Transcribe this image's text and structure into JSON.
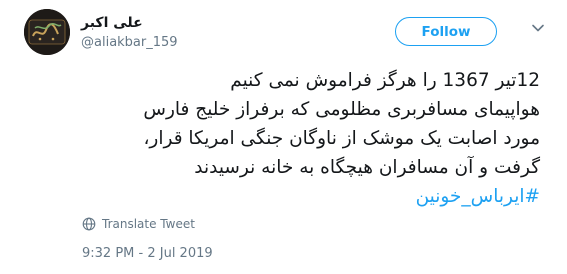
{
  "author": {
    "display_name": "علی اکبر",
    "username": "@aliakbar_159",
    "avatar_icon": "calligraphy-avatar-icon"
  },
  "follow_label": "Follow",
  "caret_icon": "chevron-down-icon",
  "tweet": {
    "lines": [
      "12تیر 1367 را هرگز فراموش نمی کنیم",
      "هواپیمای مسافربری مظلومی که برفراز خلیج فارس",
      "مورد اصابت یک موشک از ناوگان جنگی امریکا قرار،",
      "گرفت و آن مسافران هیچگاه به خانه نرسیدند"
    ],
    "hashtag": "#ایرباس_خونین"
  },
  "translate_label": "Translate Tweet",
  "translate_icon": "globe-icon",
  "timestamp": "9:32 PM - 2 Jul 2019",
  "colors": {
    "accent": "#1da1f2",
    "secondary_text": "#657786",
    "text": "#14171a"
  }
}
